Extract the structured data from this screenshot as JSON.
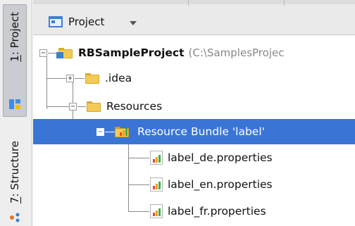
{
  "side_strip": {
    "tabs": [
      {
        "number": "1",
        "label": ": Project",
        "icon": "project-tool-icon"
      },
      {
        "number": "7",
        "label": ": Structure",
        "icon": "structure-tool-icon"
      }
    ]
  },
  "header": {
    "view_label": "Project",
    "view_icon": "project-view-icon"
  },
  "tree": {
    "root": {
      "label": "RBSampleProject",
      "path": "(C:\\SamplesProjec",
      "icon": "module-folder-icon"
    },
    "items": [
      {
        "label": ".idea",
        "icon": "folder-icon",
        "expanded": false
      },
      {
        "label": "Resources",
        "icon": "folder-icon",
        "expanded": true
      },
      {
        "label": "Resource Bundle 'label'",
        "icon": "resource-bundle-icon",
        "expanded": true,
        "selected": true
      },
      {
        "label": "label_de.properties",
        "icon": "properties-file-icon"
      },
      {
        "label": "label_en.properties",
        "icon": "properties-file-icon"
      },
      {
        "label": "label_fr.properties",
        "icon": "properties-file-icon"
      }
    ]
  },
  "colors": {
    "selection": "#3a75d6",
    "path_text": "#888888",
    "folder": "#f2cb55",
    "module_badge": "#3b7fd0",
    "bar_colors": [
      "#e8433a",
      "#f0a020",
      "#3cb04a"
    ]
  }
}
